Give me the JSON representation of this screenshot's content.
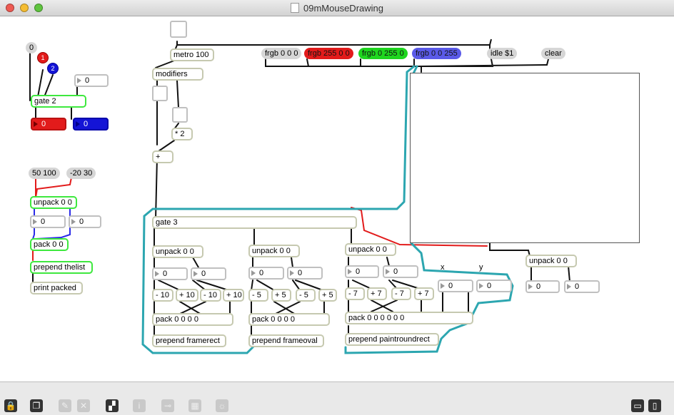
{
  "window": {
    "title": "09mMouseDrawing"
  },
  "objects": {
    "metro": "metro 100",
    "modifiers": "modifiers",
    "times2": "* 2",
    "plus": "+",
    "gate2": "gate 2",
    "gate3": "gate 3",
    "unpack_top": "unpack 0 0",
    "pack_top": "pack 0 0",
    "prepend_thelist": "prepend thelist",
    "print_packed": "print packed",
    "unpack1": "unpack 0 0",
    "unpack2": "unpack 0 0",
    "unpack3": "unpack 0 0",
    "unpack_right": "unpack 0 0",
    "minus10a": "- 10",
    "plus10a": "+ 10",
    "minus10b": "- 10",
    "plus10b": "+ 10",
    "minus5a": "- 5",
    "plus5a": "+ 5",
    "minus5b": "- 5",
    "plus5b": "+ 5",
    "minus7a": "- 7",
    "plus7a": "+ 7",
    "minus7b": "- 7",
    "plus7b": "+ 7",
    "pack1": "pack 0 0 0 0",
    "pack2": "pack 0 0 0 0",
    "pack3": "pack 0 0 0 0 0 0",
    "prepend_framerect": "prepend framerect",
    "prepend_frameoval": "prepend frameoval",
    "prepend_paintroundrect": "prepend paintroundrect"
  },
  "messages": {
    "zero": "0",
    "msg_5010": "50 100",
    "msg_2030": "-20 30",
    "frgb_black": "frgb 0 0 0",
    "frgb_red": "frgb 255 0 0",
    "frgb_green": "frgb 0 255 0",
    "frgb_blue": "frgb 0 0 255",
    "idle": "idle $1",
    "clear": "clear"
  },
  "toggles": {
    "red": "1",
    "blue": "2"
  },
  "numbers": {
    "gate_in": "0",
    "red_out": "0",
    "blue_out": "0",
    "unpack_l": "0",
    "unpack_r": "0",
    "n1a": "0",
    "n1b": "0",
    "n2a": "0",
    "n2b": "0",
    "n3a": "0",
    "n3b": "0",
    "x_num": "0",
    "y_num": "0",
    "out_l": "0",
    "out_r": "0"
  },
  "labels": {
    "x": "x",
    "y": "y"
  },
  "colors": {
    "red": "#e21b1b",
    "green": "#1fd61f",
    "blue": "#5a5ae8",
    "teal": "#2ca6b0",
    "highlight": "#3ee83e"
  }
}
